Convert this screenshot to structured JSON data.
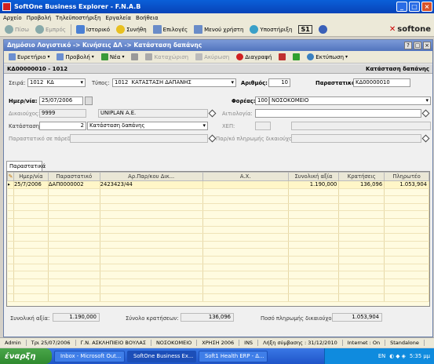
{
  "window": {
    "title": "SoftOne Business Explorer - F.N.A.B"
  },
  "menu": [
    "Αρχείο",
    "Προβολή",
    "Τηλεϋποστήριξη",
    "Εργαλεία",
    "Βοήθεια"
  ],
  "nav": {
    "back": "Πίσω",
    "forward": "Εμπρός",
    "history": "Ιστορικό",
    "favorites": "Συνήθη",
    "options": "Επιλογές",
    "user_menu": "Μενού χρήστη",
    "support": "Υποστήριξη",
    "s1": "S1",
    "logo": "softone"
  },
  "doc": {
    "title": "Δημόσιο Λογιστικό -> Κινήσεις ΔΛ -> Κατάσταση δαπάνης",
    "toolbar": {
      "find": "Ευρετήριο",
      "view": "Προβολή",
      "new": "Νέα",
      "save": "Καταχώριση",
      "print": "Ακύρωση",
      "delete": "Διαγραφή",
      "print2": "Εκτύπωση"
    },
    "header_left": "ΚΔ00000010 - 1012",
    "header_right": "Κατάσταση δαπάνης",
    "series_label": "Σειρά:",
    "series_code": "1012",
    "series_val": "ΚΔ",
    "type_label": "Τύπος:",
    "type_code": "1012",
    "type_val": "ΚΑΤΑΣΤΑΣΗ ΔΑΠΑΝΗΣ",
    "number_label": "Αριθμός:",
    "number_val": "10",
    "doc_label": "Παραστατικό:",
    "doc_val": "ΚΔ00000010",
    "date_label": "Ημερ/νία:",
    "date_val": "25/07/2006",
    "carrier_label": "Φορέας:",
    "carrier_code": "100",
    "carrier_val": "ΝΟΣΟΚΟΜΕΙΟ",
    "bene_label": "Δικαιούχος:",
    "bene_code": "9999",
    "bene_val": "UNIPLAN A.E.",
    "reason_label": "Αιτιολογία:",
    "state_label": "Κατάσταση:",
    "state_code": "2",
    "state_val": "Κατάσταση δαπάνης",
    "xep_label": "ΧΕΠ:",
    "trans_label": "Παραστατικό σε πάρεδρο:",
    "payorder_label": "Παρ/κό πληρωμής δικαιούχου:",
    "tab": "Παραστατικά"
  },
  "grid": {
    "columns": [
      "Ημερ/νία",
      "Παραστατικό",
      "Αρ.Παρ/κου Δικ...",
      "Α.Χ.",
      "Συνολική αξία",
      "Κρατήσεις",
      "Πληρωτέο"
    ],
    "rows": [
      {
        "date": "25/7/2006",
        "doc": "ΔΑΠ0000002",
        "ref": "2423423/44",
        "ax": "",
        "total": "1.190,000",
        "ret": "136,096",
        "pay": "1.053,904"
      }
    ]
  },
  "totals": {
    "total_label": "Συνολική αξία:",
    "total_val": "1.190,000",
    "ret_label": "Σύνολο κρατήσεων:",
    "ret_val": "136,096",
    "pay_label": "Ποσό πληρωμής δικαιούχου:",
    "pay_val": "1.053,904"
  },
  "status": [
    "Admin",
    "Τρι 25/07/2006",
    "Γ.Ν. ΑΣΚΛΗΠΙΕΙΟ ΒΟΥΛΑΣ",
    "ΝΟΣΟΚΟΜΕΙΟ",
    "ΧΡΗΣΗ 2006",
    "INS",
    "Λήξη σύμβασης : 31/12/2010",
    "Internet : On",
    "Standalone"
  ],
  "taskbar": {
    "start": "έναρξη",
    "tasks": [
      "Inbox - Microsoft Out...",
      "SoftOne Business Ex...",
      "Soft1 Health ERP - Δ..."
    ],
    "lang": "EN",
    "clock": "5:35 μμ"
  }
}
